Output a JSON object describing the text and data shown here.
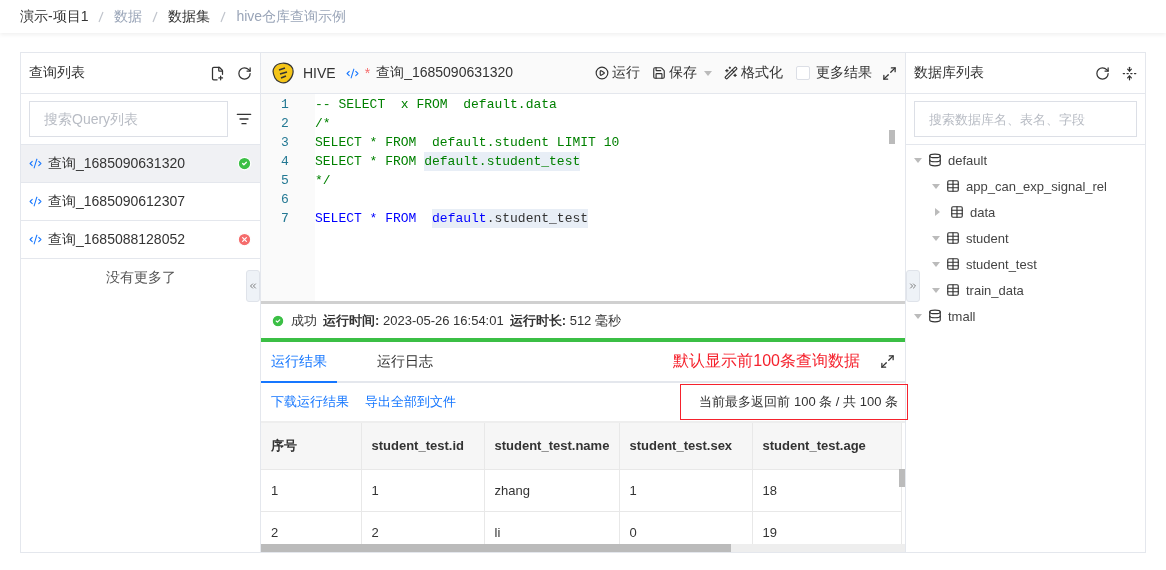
{
  "breadcrumb": [
    {
      "label": "演示-项目1",
      "kind": "dark"
    },
    {
      "label": "数据",
      "kind": "muted"
    },
    {
      "label": "数据集",
      "kind": "dark"
    },
    {
      "label": "hive仓库查询示例",
      "kind": "muted"
    }
  ],
  "query_panel": {
    "title": "查询列表",
    "search": {
      "placeholder": "搜索Query列表"
    },
    "items": [
      {
        "label": "查询_1685090631320",
        "selected": true,
        "kind": "success"
      },
      {
        "label": "查询_1685090612307",
        "selected": false,
        "kind": "plain"
      },
      {
        "label": "查询_1685088128052",
        "selected": false,
        "kind": "error"
      }
    ],
    "footer": "没有更多了"
  },
  "editor": {
    "engine": "HIVE",
    "modified_mark": "*",
    "tab_title": "查询_1685090631320",
    "toolbar": [
      {
        "kind": "run",
        "label": "运行"
      },
      {
        "kind": "save",
        "label": "保存"
      },
      {
        "kind": "format",
        "label": "格式化"
      }
    ],
    "more_results": {
      "label": "更多结果",
      "checked": false
    },
    "lines": [
      {
        "number": "1",
        "segments": [
          {
            "text": "-- SELECT  x FROM  default.data",
            "kind": "comment",
            "highlight": false
          }
        ]
      },
      {
        "number": "2",
        "segments": [
          {
            "text": "/*",
            "kind": "comment",
            "highlight": false
          }
        ]
      },
      {
        "number": "3",
        "segments": [
          {
            "text": "SELECT * FROM  default.student LIMIT 10",
            "kind": "comment",
            "highlight": false
          }
        ]
      },
      {
        "number": "4",
        "segments": [
          {
            "text": "SELECT * FROM ",
            "kind": "comment",
            "highlight": false
          },
          {
            "text": "default.student_test",
            "kind": "comment",
            "highlight": true
          }
        ]
      },
      {
        "number": "5",
        "segments": [
          {
            "text": "*/",
            "kind": "comment",
            "highlight": false
          }
        ]
      },
      {
        "number": "6"
      },
      {
        "number": "7",
        "segments": [
          {
            "text": "SELECT * FROM  ",
            "kind": "keyword",
            "highlight": false
          },
          {
            "text": "default",
            "kind": "keyword",
            "highlight": true
          },
          {
            "text": ".student_test",
            "kind": "plain",
            "highlight": true
          }
        ]
      }
    ]
  },
  "status": {
    "result": "成功",
    "success": true,
    "items": [
      {
        "label": "运行时间:",
        "value": "2023-05-26 16:54:01"
      },
      {
        "label": "运行时长:",
        "value": "512 毫秒"
      }
    ]
  },
  "result_tabs": [
    {
      "label": "运行结果",
      "selected": true
    },
    {
      "label": "运行日志",
      "selected": false
    }
  ],
  "annotation": "默认显示前100条查询数据",
  "actions": [
    {
      "label": "下载运行结果"
    },
    {
      "label": "导出全部到文件"
    }
  ],
  "result_count": "当前最多返回前 100 条 / 共 100 条",
  "table": {
    "columns": [
      "序号",
      "student_test.id",
      "student_test.name",
      "student_test.sex",
      "student_test.age"
    ],
    "rows": [
      [
        "1",
        "1",
        "zhang",
        "1",
        "18"
      ],
      [
        "2",
        "2",
        "li",
        "0",
        "19"
      ]
    ]
  },
  "db_panel": {
    "title": "数据库列表",
    "search": {
      "placeholder": "搜索数据库名、表名、字段"
    },
    "tree": [
      {
        "label": "default",
        "kind": "database",
        "expanded": true,
        "children": [
          {
            "label": "app_can_exp_signal_rel",
            "kind": "table",
            "expanded": true
          },
          {
            "label": "data",
            "kind": "table",
            "expanded": false
          },
          {
            "label": "student",
            "kind": "table",
            "expanded": true
          },
          {
            "label": "student_test",
            "kind": "table",
            "expanded": true
          },
          {
            "label": "train_data",
            "kind": "table",
            "expanded": true
          }
        ]
      },
      {
        "label": "tmall",
        "kind": "database",
        "expanded": true
      }
    ]
  }
}
